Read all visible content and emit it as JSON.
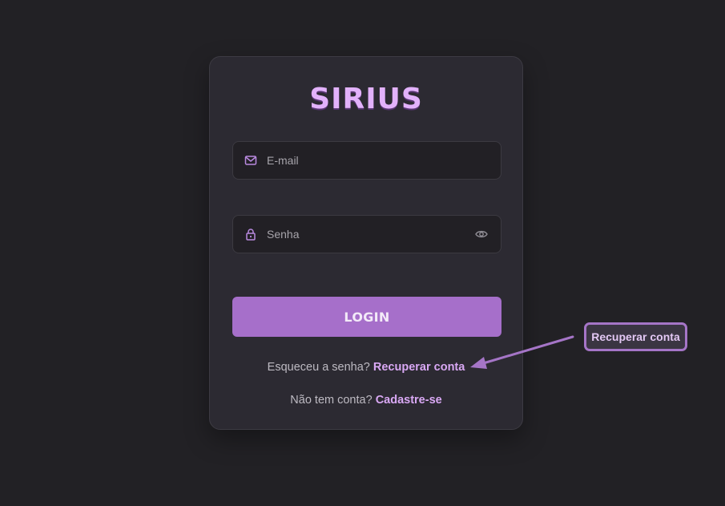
{
  "app": {
    "title": "SIRIUS"
  },
  "login_form": {
    "email": {
      "icon": "mail-icon",
      "placeholder": "E-mail",
      "value": ""
    },
    "password": {
      "icon": "lock-icon",
      "placeholder": "Senha",
      "value": "",
      "toggle_icon": "eye-icon"
    },
    "submit_label": "LOGIN",
    "forgot_prompt": "Esqueceu a senha?",
    "forgot_link": "Recuperar conta",
    "signup_prompt": "Não tem conta?",
    "signup_link": "Cadastre-se"
  },
  "annotation": {
    "label": "Recuperar conta"
  },
  "colors": {
    "page_background": "#222125",
    "card_background": "#2c2a32",
    "accent": "#a66fca",
    "title": "#e2b1fb",
    "link": "#d9a8f4"
  }
}
